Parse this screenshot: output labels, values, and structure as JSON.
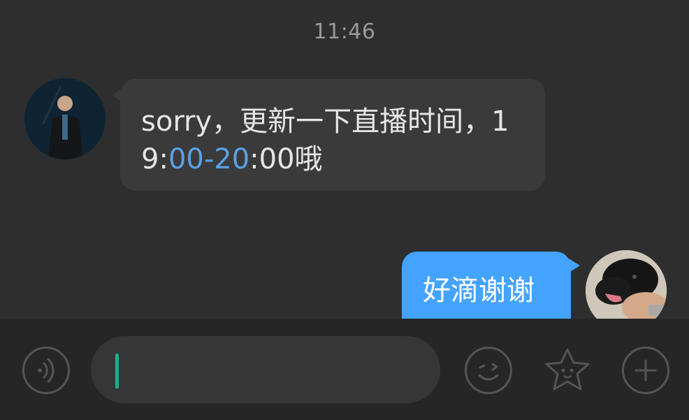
{
  "chat": {
    "timestamp": "11:46",
    "messages": [
      {
        "direction": "incoming",
        "avatar_icon": "contact-avatar",
        "text_parts": [
          "sorry，更新一下直播时间，19:",
          "00-20",
          ":00哦"
        ]
      },
      {
        "direction": "outgoing",
        "avatar_icon": "dog-avatar",
        "text": "好滴谢谢"
      }
    ]
  },
  "input_bar": {
    "voice_icon": "voice-icon",
    "input_value": "",
    "emoji_icon": "emoji-icon",
    "favorites_icon": "star-sticker-icon",
    "plus_icon": "plus-icon"
  },
  "colors": {
    "background": "#2e2e2e",
    "incoming_bubble": "#3a3a3a",
    "outgoing_bubble": "#44a3ff",
    "link": "#5aa0e6",
    "caret": "#1fae8e",
    "input_bar": "#262626"
  }
}
